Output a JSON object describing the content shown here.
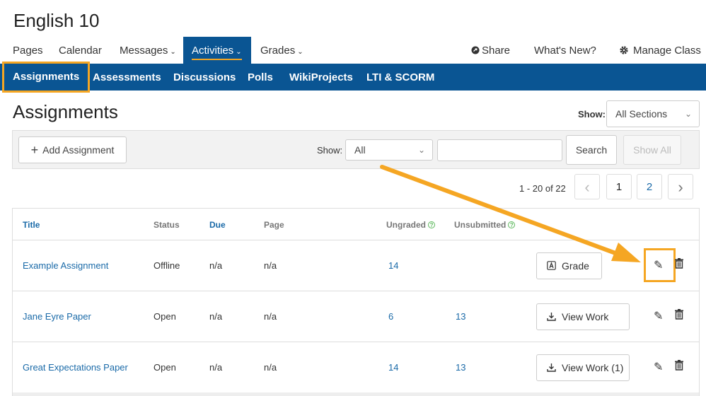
{
  "course": {
    "title": "English 10"
  },
  "top_nav": {
    "pages": "Pages",
    "calendar": "Calendar",
    "messages": "Messages",
    "activities": "Activities",
    "grades": "Grades",
    "share": "Share",
    "whats_new": "What's New?",
    "manage_class": "Manage Class"
  },
  "sub_nav": {
    "assignments": "Assignments",
    "assessments": "Assessments",
    "discussions": "Discussions",
    "polls": "Polls",
    "wikiprojects": "WikiProjects",
    "lti_scorm": "LTI & SCORM"
  },
  "page": {
    "title": "Assignments",
    "show_label": "Show:",
    "sections_selected": "All Sections"
  },
  "toolbar": {
    "add_assignment": "Add Assignment",
    "show_label": "Show:",
    "filter_selected": "All",
    "search_value": "",
    "search_button": "Search",
    "show_all_button": "Show All"
  },
  "pagination": {
    "info": "1 - 20 of 22",
    "prev": "‹",
    "pages": [
      "1",
      "2"
    ],
    "next": "›"
  },
  "table": {
    "headers": {
      "title": "Title",
      "status": "Status",
      "due": "Due",
      "page": "Page",
      "ungraded": "Ungraded",
      "unsubmitted": "Unsubmitted"
    },
    "rows": [
      {
        "title": "Example Assignment",
        "status": "Offline",
        "due": "n/a",
        "page": "n/a",
        "ungraded": "14",
        "unsubmitted": "",
        "action": "Grade"
      },
      {
        "title": "Jane Eyre Paper",
        "status": "Open",
        "due": "n/a",
        "page": "n/a",
        "ungraded": "6",
        "unsubmitted": "13",
        "action": "View Work"
      },
      {
        "title": "Great Expectations Paper",
        "status": "Open",
        "due": "n/a",
        "page": "n/a",
        "ungraded": "14",
        "unsubmitted": "13",
        "action": "View Work (1)"
      }
    ]
  },
  "colors": {
    "brand_blue": "#0a5593",
    "highlight_orange": "#f5a623",
    "link_blue": "#1a6aa8"
  },
  "icons": {
    "share": "share-icon",
    "gear": "gear-icon",
    "plus": "plus-icon",
    "grade": "grade-icon",
    "download": "download-icon",
    "edit": "pencil-icon",
    "delete": "trash-icon"
  }
}
